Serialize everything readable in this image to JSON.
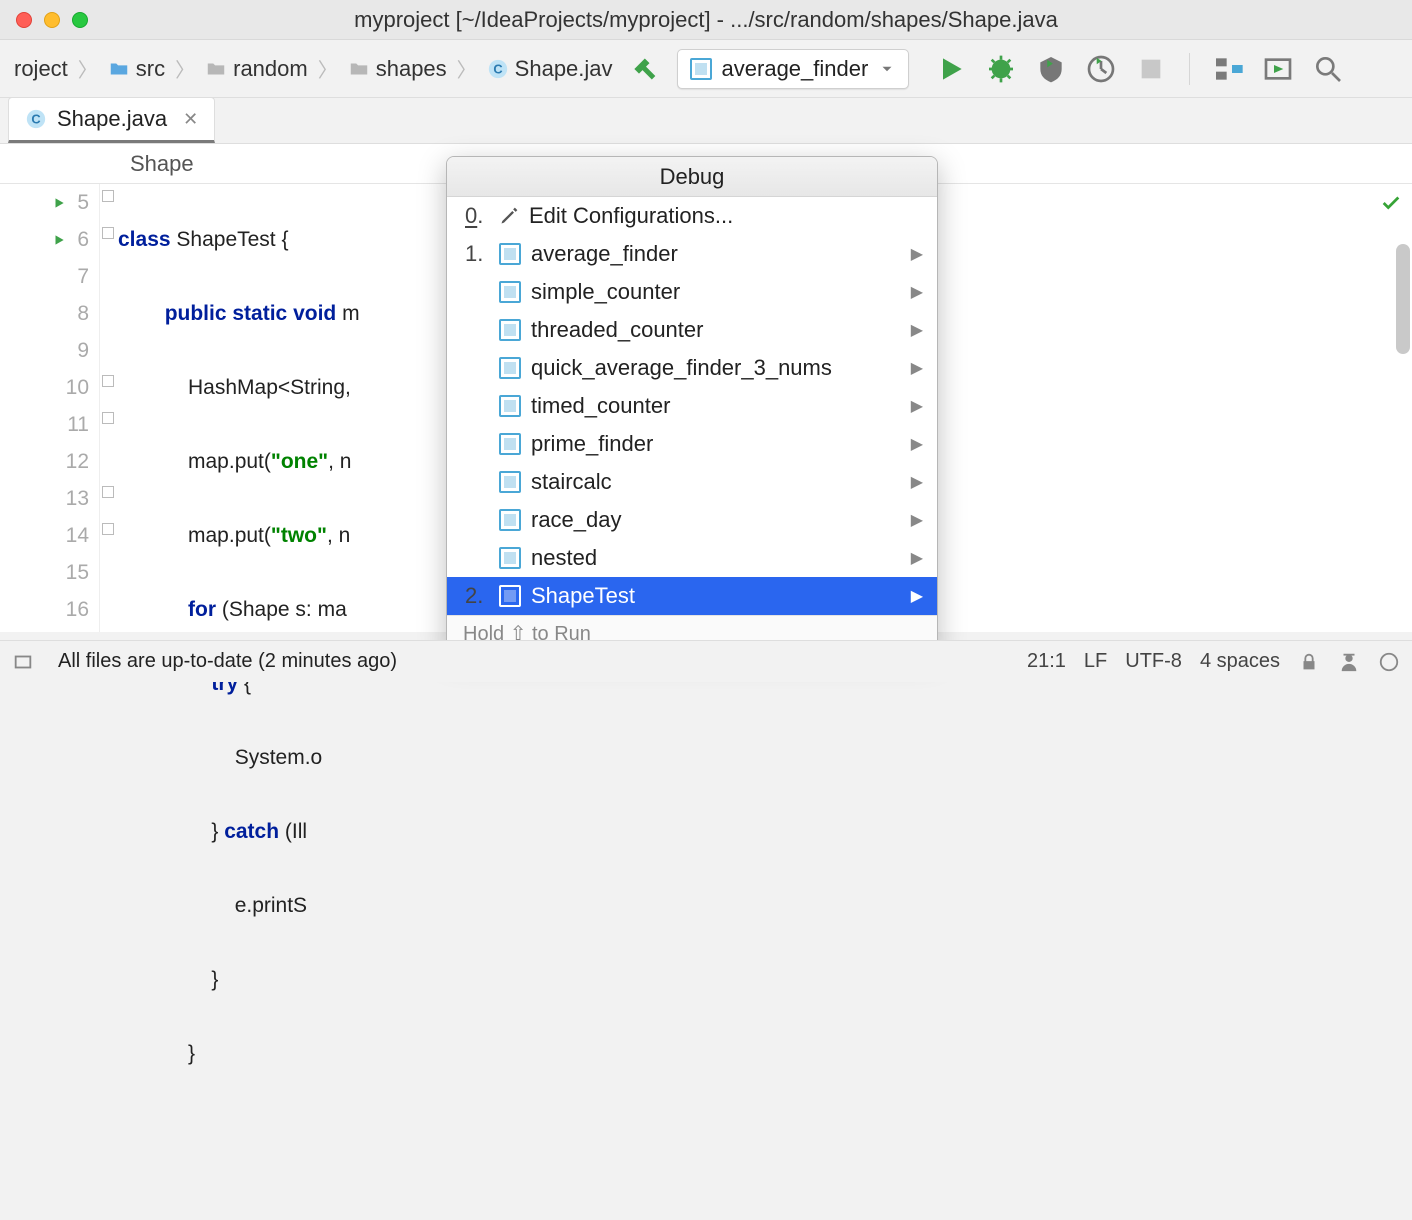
{
  "window": {
    "title": "myproject [~/IdeaProjects/myproject] - .../src/random/shapes/Shape.java"
  },
  "breadcrumbs": {
    "project": "roject",
    "src": "src",
    "random": "random",
    "shapes": "shapes",
    "file": "Shape.jav"
  },
  "run_config": {
    "selected": "average_finder"
  },
  "tab": {
    "name": "Shape.java"
  },
  "breadcrumb_class": "Shape",
  "gutter_lines": [
    "5",
    "6",
    "7",
    "8",
    "9",
    "10",
    "11",
    "12",
    "13",
    "14",
    "15",
    "16"
  ],
  "code": {
    "l5_kw": "class",
    "l5_rest": " ShapeTest {",
    "l6_kw1": "public",
    "l6_kw2": "static",
    "l6_kw3": "void",
    "l6_rest": " m",
    "l7": "            HashMap<String, ",
    "l8a": "            map.put(",
    "l8s": "\"one\"",
    "l8b": ", n",
    "l9a": "            map.put(",
    "l9s": "\"two\"",
    "l9b": ", n",
    "l10_kw": "for",
    "l10_rest": " (Shape s: ma",
    "l11_kw": "try",
    "l11_rest": " {",
    "l12": "                    System.o",
    "l13a": "                } ",
    "l13_kw": "catch",
    "l13b": " (Ill",
    "l14": "                    e.printS",
    "l15": "                }",
    "l16": "            }"
  },
  "popup": {
    "title": "Debug",
    "edit_prefix_underline": "0",
    "edit_prefix_rest": ".",
    "edit_label": "Edit Configurations...",
    "hold_hint": "Hold ⇧ to Run",
    "items": [
      {
        "num": "1.",
        "label": "average_finder"
      },
      {
        "num": "",
        "label": "simple_counter"
      },
      {
        "num": "",
        "label": "threaded_counter"
      },
      {
        "num": "",
        "label": "quick_average_finder_3_nums"
      },
      {
        "num": "",
        "label": "timed_counter"
      },
      {
        "num": "",
        "label": "prime_finder"
      },
      {
        "num": "",
        "label": "staircalc"
      },
      {
        "num": "",
        "label": "race_day"
      },
      {
        "num": "",
        "label": "nested"
      },
      {
        "num": "2.",
        "label": "ShapeTest",
        "selected": true
      }
    ]
  },
  "status": {
    "message": "All files are up-to-date (2 minutes ago)",
    "caret": "21:1",
    "line_sep": "LF",
    "encoding": "UTF-8",
    "indent": "4 spaces"
  }
}
